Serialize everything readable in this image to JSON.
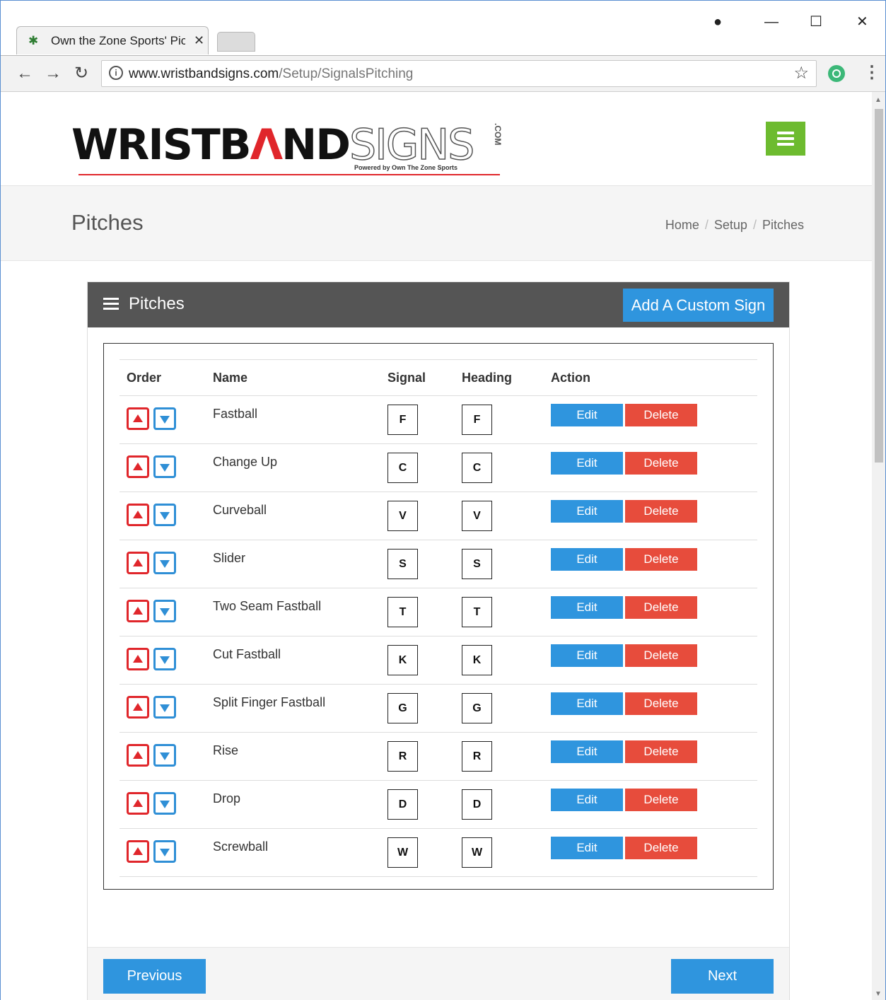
{
  "browser": {
    "tab_title": "Own the Zone Sports' Pic",
    "tab_close": "✕",
    "favicon": "✱",
    "url_host": "www.wristbandsigns.com",
    "url_path": "/Setup/SignalsPitching",
    "icons": [
      "back-icon",
      "forward-icon",
      "reload-icon",
      "info-icon",
      "star-icon",
      "extension-icon",
      "menu-icon",
      "account-icon",
      "minimize-icon",
      "maximize-icon",
      "close-icon"
    ]
  },
  "header": {
    "logo_text_a": "WRISTB",
    "logo_text_b": "ND",
    "logo_text_c": "SIGNS",
    "logo_sub": "Powered by Own The Zone Sports",
    "logo_com": ".COM",
    "menu_color": "#6dbb2f"
  },
  "page": {
    "title": "Pitches",
    "breadcrumb": [
      "Home",
      "Setup",
      "Pitches"
    ]
  },
  "panel": {
    "title": "Pitches",
    "add_button": "Add A Custom Sign",
    "columns": [
      "Order",
      "Name",
      "Signal",
      "Heading",
      "Action"
    ],
    "rows": [
      {
        "name": "Fastball",
        "signal": "F",
        "heading": "F"
      },
      {
        "name": "Change Up",
        "signal": "C",
        "heading": "C"
      },
      {
        "name": "Curveball",
        "signal": "V",
        "heading": "V"
      },
      {
        "name": "Slider",
        "signal": "S",
        "heading": "S"
      },
      {
        "name": "Two Seam Fastball",
        "signal": "T",
        "heading": "T"
      },
      {
        "name": "Cut Fastball",
        "signal": "K",
        "heading": "K"
      },
      {
        "name": "Split Finger Fastball",
        "signal": "G",
        "heading": "G"
      },
      {
        "name": "Rise",
        "signal": "R",
        "heading": "R"
      },
      {
        "name": "Drop",
        "signal": "D",
        "heading": "D"
      },
      {
        "name": "Screwball",
        "signal": "W",
        "heading": "W"
      }
    ],
    "edit_label": "Edit",
    "delete_label": "Delete",
    "previous_label": "Previous",
    "next_label": "Next"
  },
  "colors": {
    "primary": "#2f95de",
    "danger": "#e74c3c",
    "panel_header": "#555555",
    "accent_red": "#e0262b"
  }
}
